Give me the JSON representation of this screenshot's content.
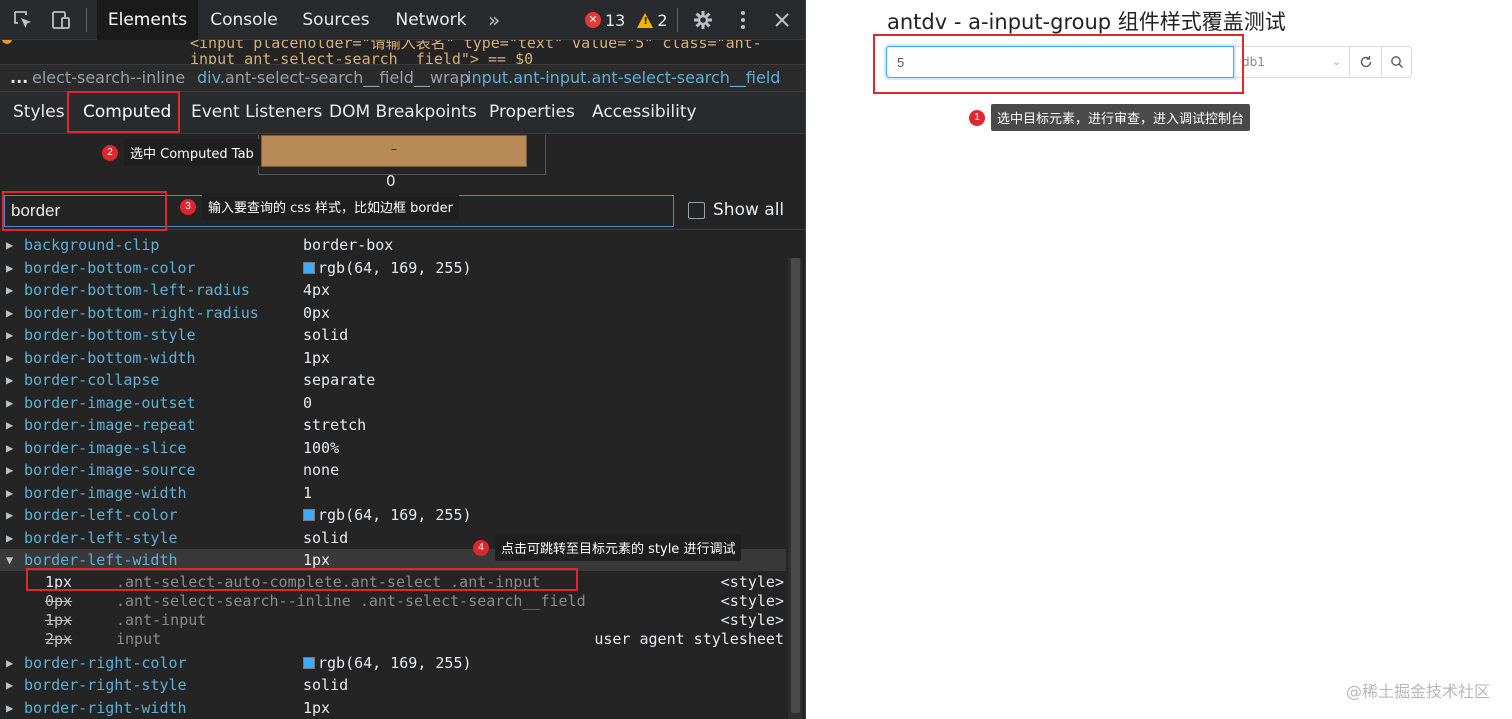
{
  "devtools": {
    "tabs": [
      "Elements",
      "Console",
      "Sources",
      "Network"
    ],
    "more_tabs": "»",
    "errors": "13",
    "warnings": "2",
    "code_line1": "<input placeholder=\"请输入表名\" type=\"text\" value=\"5\" class=\"ant-",
    "code_line2": "input ant-select-search__field\"> == $0",
    "breadcrumbs": [
      {
        "tag": "...",
        "cls": ""
      },
      {
        "tag": "",
        "cls": "elect-search--inline"
      },
      {
        "tag": "div",
        "cls": ".ant-select-search__field__wrap"
      },
      {
        "tag": "input",
        "cls": ".ant-input.ant-select-search__field"
      }
    ],
    "subtabs": [
      "Styles",
      "Computed",
      "Event Listeners",
      "DOM Breakpoints",
      "Properties",
      "Accessibility"
    ],
    "box_model_dash": "–",
    "box_model_zero": "0",
    "filter_value": "border",
    "show_all_label": "Show all",
    "properties": [
      {
        "name": "background-clip",
        "value": "border-box",
        "swatch": false
      },
      {
        "name": "border-bottom-color",
        "value": "rgb(64, 169, 255)",
        "swatch": true
      },
      {
        "name": "border-bottom-left-radius",
        "value": "4px",
        "swatch": false
      },
      {
        "name": "border-bottom-right-radius",
        "value": "0px",
        "swatch": false
      },
      {
        "name": "border-bottom-style",
        "value": "solid",
        "swatch": false
      },
      {
        "name": "border-bottom-width",
        "value": "1px",
        "swatch": false
      },
      {
        "name": "border-collapse",
        "value": "separate",
        "swatch": false
      },
      {
        "name": "border-image-outset",
        "value": "0",
        "swatch": false
      },
      {
        "name": "border-image-repeat",
        "value": "stretch",
        "swatch": false
      },
      {
        "name": "border-image-slice",
        "value": "100%",
        "swatch": false
      },
      {
        "name": "border-image-source",
        "value": "none",
        "swatch": false
      },
      {
        "name": "border-image-width",
        "value": "1",
        "swatch": false
      },
      {
        "name": "border-left-color",
        "value": "rgb(64, 169, 255)",
        "swatch": true
      },
      {
        "name": "border-left-style",
        "value": "solid",
        "swatch": false
      },
      {
        "name": "border-left-width",
        "value": "1px",
        "swatch": false,
        "expanded": true
      }
    ],
    "trace": [
      {
        "value": "1px",
        "selector": ".ant-select-auto-complete.ant-select .ant-input",
        "source": "<style>",
        "strike": false
      },
      {
        "value": "0px",
        "selector": ".ant-select-search--inline .ant-select-search__field",
        "source": "<style>",
        "strike": true
      },
      {
        "value": "1px",
        "selector": ".ant-input",
        "source": "<style>",
        "strike": true
      },
      {
        "value": "2px",
        "selector": "input",
        "source": "user agent stylesheet",
        "strike": true
      }
    ],
    "properties_after": [
      {
        "name": "border-right-color",
        "value": "rgb(64, 169, 255)",
        "swatch": true
      },
      {
        "name": "border-right-style",
        "value": "solid",
        "swatch": false
      },
      {
        "name": "border-right-width",
        "value": "1px",
        "swatch": false
      }
    ],
    "swatch_color": "#40a9ff"
  },
  "annotations": [
    {
      "num": "1",
      "text": "选中目标元素，进行审查，进入调试控制台"
    },
    {
      "num": "2",
      "text": "选中 Computed Tab"
    },
    {
      "num": "3",
      "text": "输入要查询的 css 样式，比如边框 border"
    },
    {
      "num": "4",
      "text": "点击可跳转至目标元素的 style 进行调试"
    }
  ],
  "page": {
    "title": "antdv - a-input-group 组件样式覆盖测试",
    "input_value": "5",
    "select_value": "db1",
    "watermark": "@稀土掘金技术社区"
  },
  "colors": {
    "highlight": "#e0262f",
    "accent": "#40a9ff"
  }
}
